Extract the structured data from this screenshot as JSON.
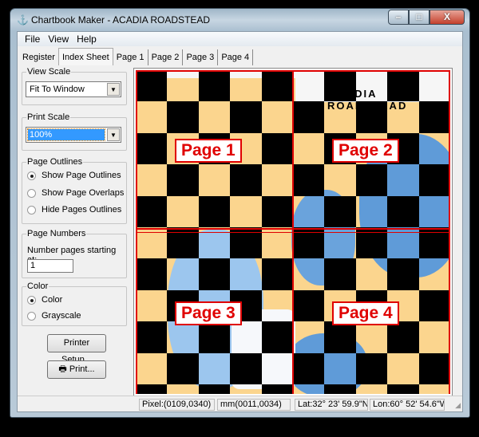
{
  "window": {
    "title": "Chartbook Maker - ACADIA ROADSTEAD",
    "controls": {
      "minimize": "–",
      "maximize": "□",
      "close": "X"
    }
  },
  "menu": [
    "File",
    "View",
    "Help"
  ],
  "tabs": [
    {
      "label": "Register"
    },
    {
      "label": "Index Sheet",
      "active": true
    },
    {
      "label": "Page 1"
    },
    {
      "label": "Page 2"
    },
    {
      "label": "Page 3"
    },
    {
      "label": "Page 4"
    }
  ],
  "panel": {
    "view_scale": {
      "label": "View Scale",
      "value": "Fit To Window"
    },
    "print_scale": {
      "label": "Print Scale",
      "value": "100%"
    },
    "page_outlines": {
      "label": "Page Outlines",
      "options": [
        {
          "label": "Show Page Outlines",
          "checked": true
        },
        {
          "label": "Show Page Overlaps",
          "checked": false
        },
        {
          "label": "Hide Pages Outlines",
          "checked": false
        }
      ]
    },
    "page_numbers": {
      "label": "Page Numbers",
      "caption": "Number pages starting at:",
      "value": "1"
    },
    "color": {
      "label": "Color",
      "options": [
        {
          "label": "Color",
          "checked": true
        },
        {
          "label": "Grayscale",
          "checked": false
        }
      ]
    },
    "printer_setup": "Printer Setup...",
    "print": "Print..."
  },
  "map": {
    "pages": [
      "Page 1",
      "Page 2",
      "Page 3",
      "Page 4"
    ],
    "outline_color": "#e00000",
    "chart_title": "ACADIA ROADSTEAD"
  },
  "status": {
    "pixel": "Pixel:(0109,0340)",
    "mm": "mm(0011,0034)",
    "lat": "Lat:32° 23' 59.9\"N",
    "lon": "Lon:60° 52' 54.6\"W"
  }
}
